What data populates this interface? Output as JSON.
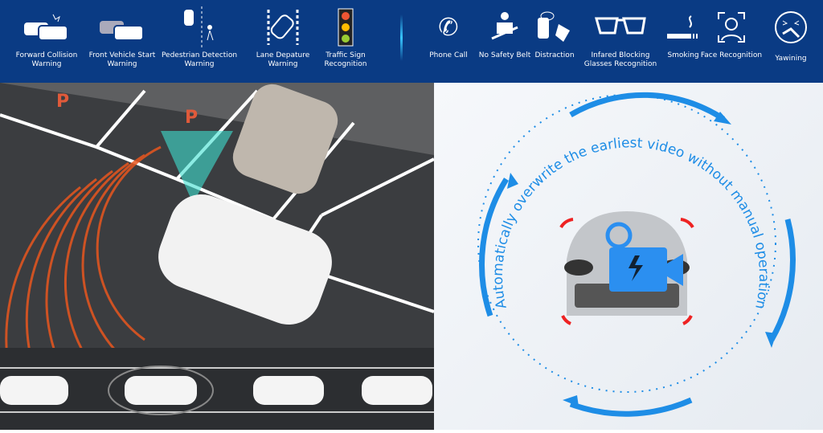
{
  "header": {
    "adas": [
      {
        "icon": "collision-cars-icon",
        "label": "Forward Collision Warning"
      },
      {
        "icon": "front-vehicle-start-icon",
        "label": "Front Vehicle Start Warning"
      },
      {
        "icon": "pedestrian-icon",
        "label": "Pedestrian Detection Warning"
      },
      {
        "icon": "lane-departure-icon",
        "label": "Lane Depature Warning"
      },
      {
        "icon": "traffic-light-icon",
        "label": "Traffic Sign Recognition"
      }
    ],
    "dms": [
      {
        "icon": "phone-icon",
        "label": "Phone Call"
      },
      {
        "icon": "seat-belt-icon",
        "label": "No Safety Belt"
      },
      {
        "icon": "distraction-icon",
        "label": "Distraction"
      },
      {
        "icon": "glasses-icon",
        "label": "Infared Blocking Glasses Recognition"
      },
      {
        "icon": "smoking-icon",
        "label": "Smoking"
      },
      {
        "icon": "face-recognition-icon",
        "label": "Face Recognition"
      },
      {
        "icon": "yawning-icon",
        "label": "Yawining"
      }
    ]
  },
  "loop": {
    "text": "Automatically overwrite the earliest video without manual operation"
  },
  "colors": {
    "header": "#0a3b84",
    "radar": "#e8561e",
    "sensor": "#3fe0d0",
    "arrow": "#1e8de6"
  }
}
